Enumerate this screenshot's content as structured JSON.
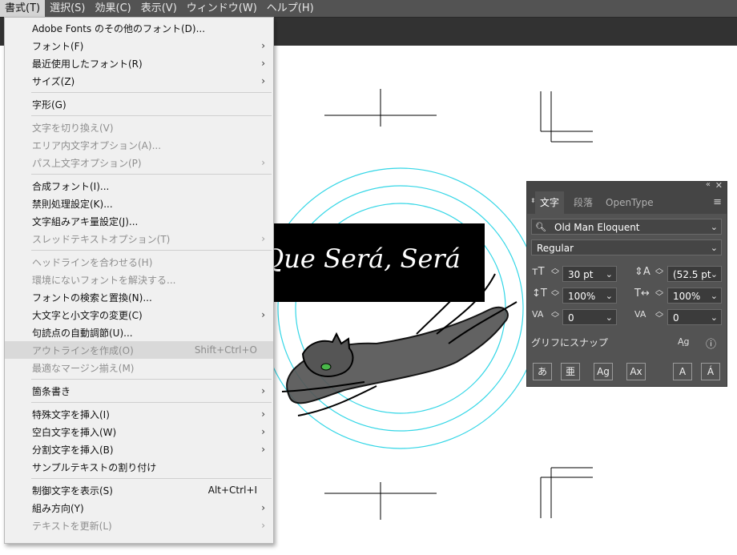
{
  "menubar": {
    "items": [
      {
        "label": "書式(T)",
        "active": true
      },
      {
        "label": "選択(S)"
      },
      {
        "label": "効果(C)"
      },
      {
        "label": "表示(V)"
      },
      {
        "label": "ウィンドウ(W)"
      },
      {
        "label": "ヘルプ(H)"
      }
    ]
  },
  "type_menu": {
    "items": [
      {
        "label": "Adobe Fonts のその他のフォント(D)..."
      },
      {
        "label": "フォント(F)",
        "submenu": true
      },
      {
        "label": "最近使用したフォント(R)",
        "submenu": true
      },
      {
        "label": "サイズ(Z)",
        "submenu": true
      },
      {
        "label": "字形(G)"
      },
      {
        "label": "文字を切り換え(V)",
        "disabled": true
      },
      {
        "label": "エリア内文字オプション(A)...",
        "disabled": true
      },
      {
        "label": "パス上文字オプション(P)",
        "disabled": true,
        "submenu": true
      },
      {
        "label": "合成フォント(I)..."
      },
      {
        "label": "禁則処理設定(K)..."
      },
      {
        "label": "文字組みアキ量設定(J)..."
      },
      {
        "label": "スレッドテキストオプション(T)",
        "disabled": true,
        "submenu": true
      },
      {
        "label": "ヘッドラインを合わせる(H)",
        "disabled": true
      },
      {
        "label": "環境にないフォントを解決する...",
        "disabled": true
      },
      {
        "label": "フォントの検索と置換(N)..."
      },
      {
        "label": "大文字と小文字の変更(C)",
        "submenu": true
      },
      {
        "label": "句読点の自動調節(U)..."
      },
      {
        "label": "アウトラインを作成(O)",
        "disabled": true,
        "shortcut": "Shift+Ctrl+O",
        "highlight": true
      },
      {
        "label": "最適なマージン揃え(M)",
        "disabled": true
      },
      {
        "label": "箇条書き",
        "submenu": true
      },
      {
        "label": "特殊文字を挿入(I)",
        "submenu": true
      },
      {
        "label": "空白文字を挿入(W)",
        "submenu": true
      },
      {
        "label": "分割文字を挿入(B)",
        "submenu": true
      },
      {
        "label": "サンプルテキストの割り付け"
      },
      {
        "label": "制御文字を表示(S)",
        "shortcut": "Alt+Ctrl+I"
      },
      {
        "label": "組み方向(Y)",
        "submenu": true
      },
      {
        "label": "テキストを更新(L)",
        "disabled": true,
        "submenu": true
      }
    ]
  },
  "artwork": {
    "banner_text": "Que Será, Será",
    "ring_color": "#33d6e6",
    "banner_color": "#000000"
  },
  "character_panel": {
    "tabs": [
      {
        "label": "文字",
        "active": true
      },
      {
        "label": "段落"
      },
      {
        "label": "OpenType"
      }
    ],
    "font_family": "Old Man Eloquent",
    "font_style": "Regular",
    "font_size": "30 pt",
    "leading": "(52.5 pt",
    "vertical_scale": "100%",
    "horizontal_scale": "100%",
    "kerning": "0",
    "tracking": "0",
    "snap_label": "グリフにスナップ",
    "glyph_buttons": [
      "あ",
      "亜",
      "Ag",
      "Ax",
      "A",
      "Á"
    ]
  }
}
